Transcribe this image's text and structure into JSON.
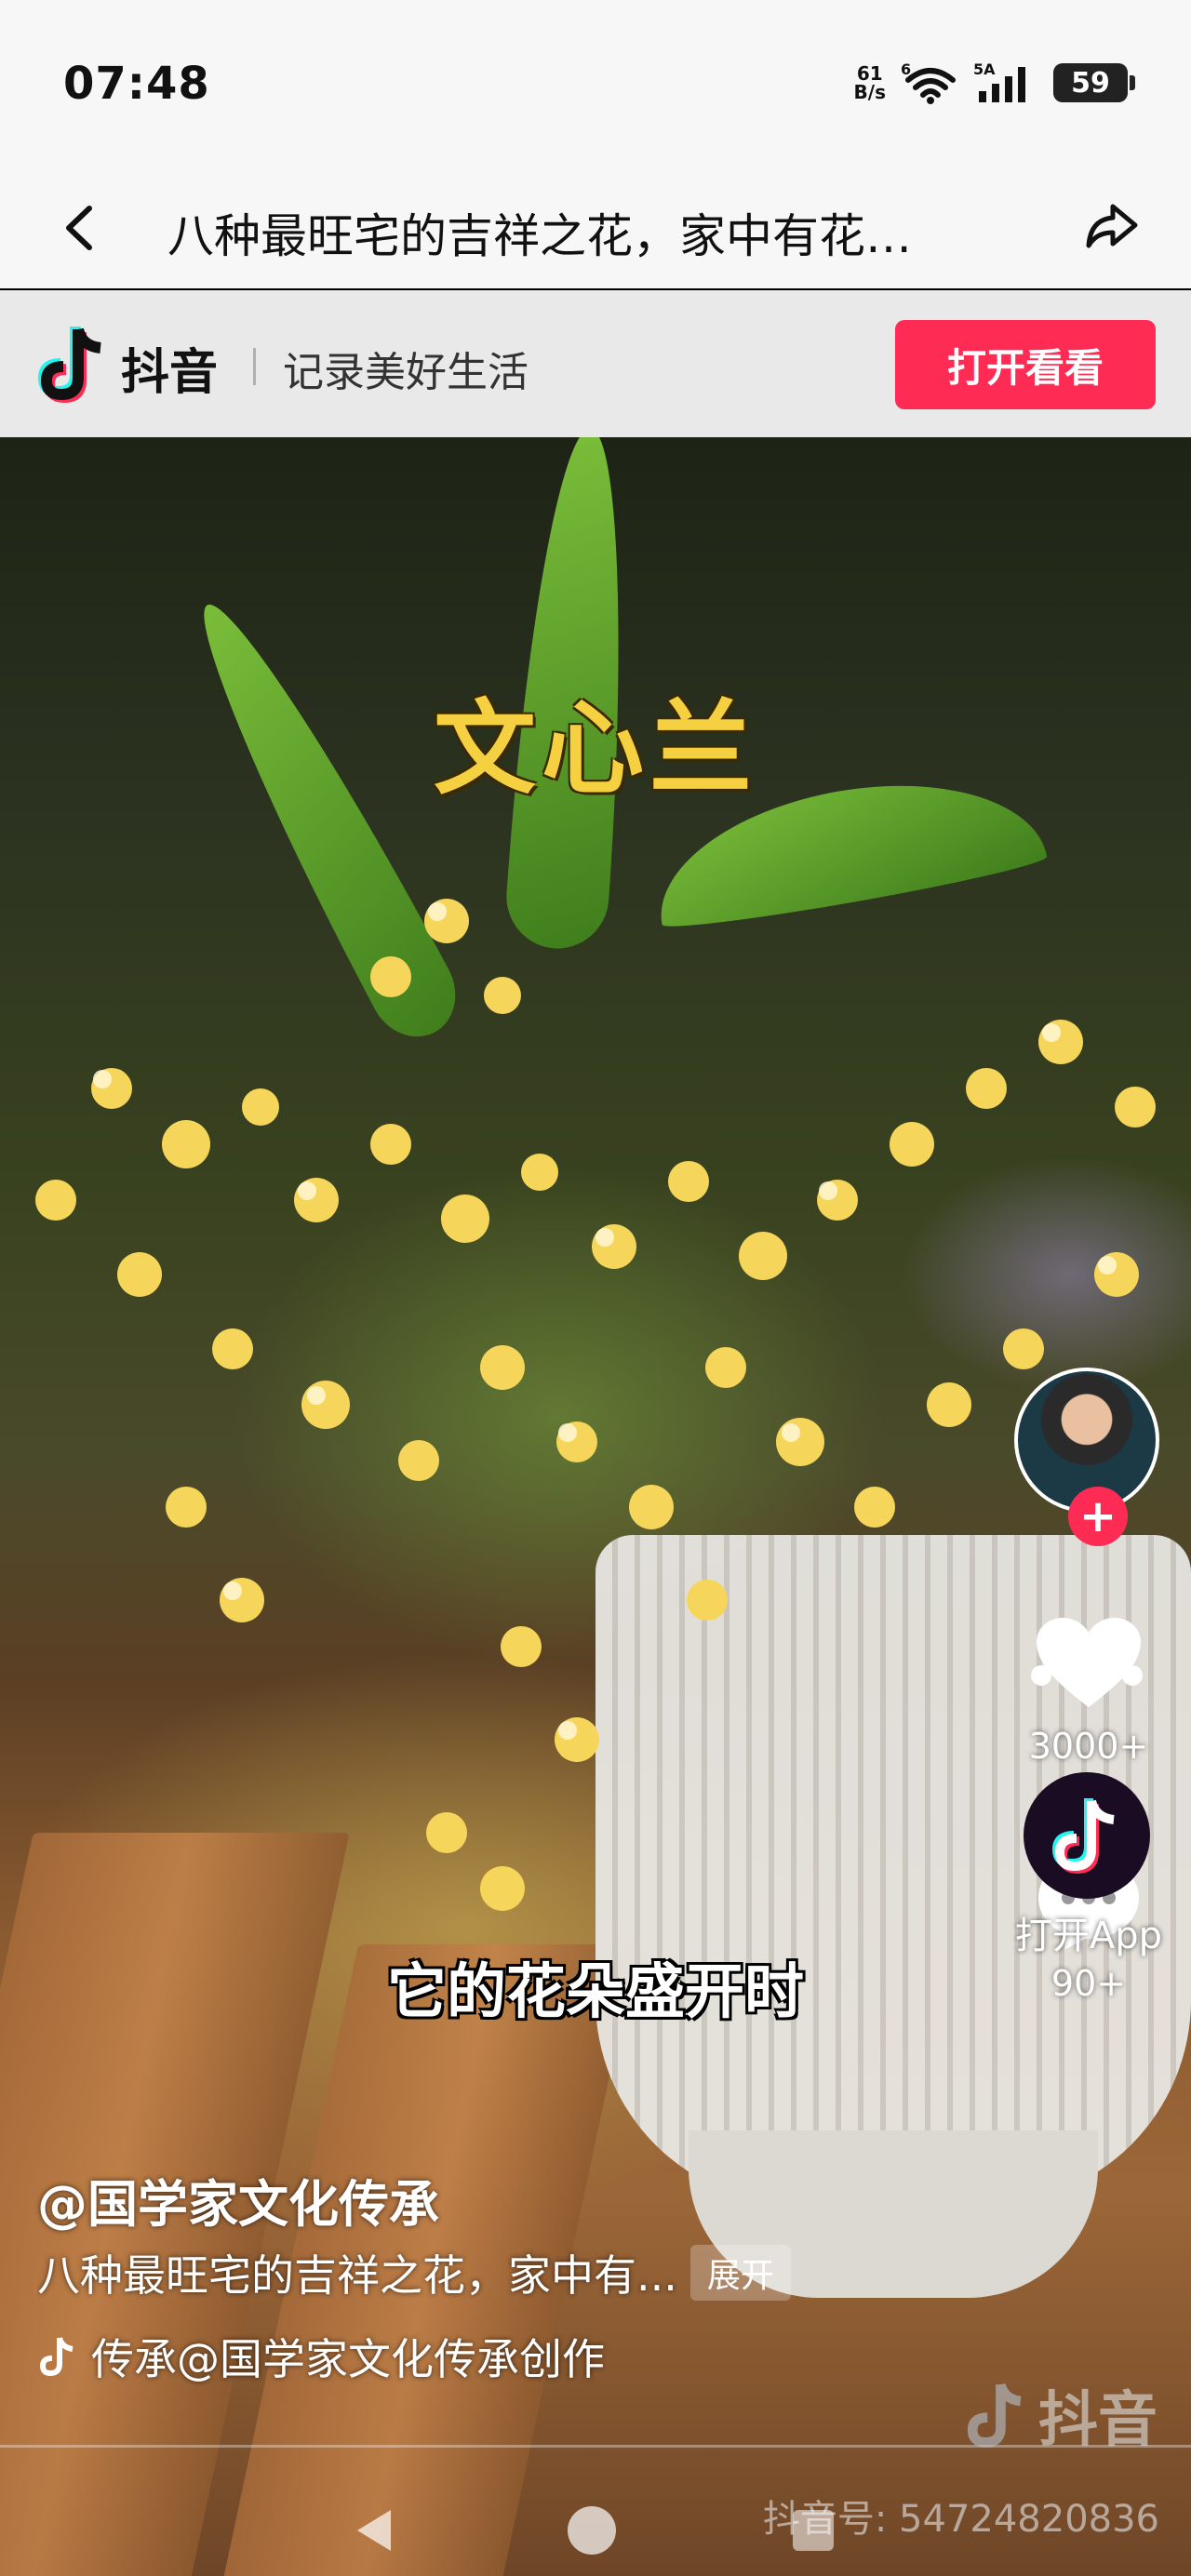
{
  "status_bar": {
    "time": "07:48",
    "net_speed_value": "61",
    "net_speed_unit": "B/s",
    "wifi_badge": "6",
    "cell_badge": "5A",
    "battery": "59"
  },
  "title_bar": {
    "title": "八种最旺宅的吉祥之花，家中有花…"
  },
  "banner": {
    "brand": "抖音",
    "slogan": "记录美好生活",
    "open_button": "打开看看"
  },
  "video": {
    "overlay_title": "文心兰",
    "subtitle": "它的花朵盛开时"
  },
  "rail": {
    "follow_symbol": "+",
    "like_count": "3000+",
    "comment_count": "90+",
    "app_label": "打开App"
  },
  "info": {
    "author": "@国学家文化传承",
    "description": "八种最旺宅的吉祥之花，家中有...",
    "expand_label": "展开",
    "music": "传承@国学家文化传承创作"
  },
  "watermark": {
    "brand": "抖音",
    "id": "抖音号: 54724820836"
  },
  "colors": {
    "accent": "#fe2c55",
    "overlay_title": "#f5d142"
  }
}
